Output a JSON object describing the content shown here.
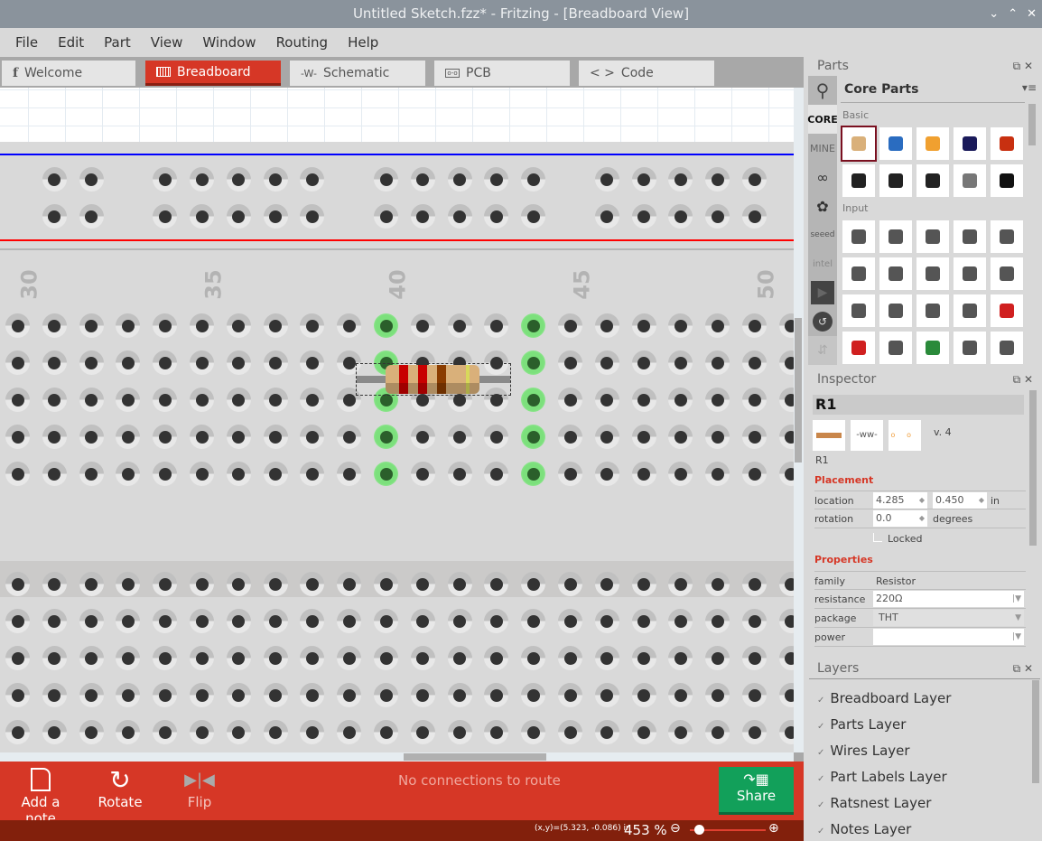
{
  "window": {
    "title": "Untitled Sketch.fzz* - Fritzing - [Breadboard View]",
    "controls": [
      "minimize",
      "maximize",
      "close"
    ]
  },
  "menu": [
    "File",
    "Edit",
    "Part",
    "View",
    "Window",
    "Routing",
    "Help"
  ],
  "tabs": [
    {
      "label": "Welcome",
      "icon": "fritzing-f-icon",
      "active": false
    },
    {
      "label": "Breadboard",
      "icon": "breadboard-icon",
      "active": true
    },
    {
      "label": "Schematic",
      "icon": "resistor-zigzag-icon",
      "active": false
    },
    {
      "label": "PCB",
      "icon": "pcb-icon",
      "active": false
    },
    {
      "label": "Code",
      "icon": "code-brackets-icon",
      "active": false
    }
  ],
  "breadboard": {
    "column_labels": [
      "30",
      "35",
      "40",
      "45",
      "50"
    ],
    "rail_top_color": "#0000ff",
    "rail_bottom_color": "#ff0000",
    "selected_part": {
      "name": "R1",
      "bands": [
        "red",
        "red",
        "brown",
        "gold"
      ]
    }
  },
  "toolbar": {
    "add_note": "Add a note",
    "rotate": "Rotate",
    "flip": "Flip",
    "routing_status": "No connections to route",
    "share": "Share"
  },
  "status": {
    "coords": "(x,y)=(5.323, -0.086) in",
    "zoom": "453 %",
    "zoom_slider_fraction": 0.12
  },
  "parts": {
    "title": "Parts",
    "bin_title": "Core Parts",
    "bins": [
      "CORE",
      "MINE",
      "arduino",
      "sparkfun",
      "seeed",
      "intel",
      "snootlab",
      "lilypad",
      "scroll"
    ],
    "sections": [
      {
        "label": "Basic",
        "items": [
          "resistor",
          "ceramic-capacitor",
          "tantalum-capacitor",
          "electrolytic-capacitor",
          "inductor",
          "diode",
          "pnp-transistor",
          "npn-transistor",
          "fet-transistor",
          "mystery-part"
        ]
      },
      {
        "label": "Input",
        "items": [
          "potentiometer",
          "rotary-potentiometer",
          "slide-potentiometer",
          "membrane-potentiometer",
          "trimmer",
          "rotary-encoder",
          "reed-switch",
          "pushbutton",
          "slide-switch",
          "tilt-sensor",
          "force-sensor",
          "flex-sensor",
          "photocell",
          "distance-sensor",
          "accelerometer",
          "breakout-board",
          "temperature-sensor",
          "sensor-module",
          "reed-tube",
          "antenna"
        ]
      }
    ]
  },
  "inspector": {
    "title": "Inspector",
    "part_title": "R1",
    "version": "v. 4",
    "part_label": "R1",
    "placement_label": "Placement",
    "location_label": "location",
    "location_x": "4.285",
    "location_y": "0.450",
    "location_unit": "in",
    "rotation_label": "rotation",
    "rotation": "0.0",
    "rotation_unit": "degrees",
    "locked_label": "Locked",
    "properties_label": "Properties",
    "properties": [
      {
        "name": "family",
        "value": "Resistor"
      },
      {
        "name": "resistance",
        "value": "220Ω"
      },
      {
        "name": "package",
        "value": "THT"
      },
      {
        "name": "power",
        "value": ""
      }
    ]
  },
  "layers": {
    "title": "Layers",
    "items": [
      "Breadboard Layer",
      "Parts Layer",
      "Wires Layer",
      "Part Labels Layer",
      "Ratsnest Layer",
      "Notes Layer"
    ]
  }
}
